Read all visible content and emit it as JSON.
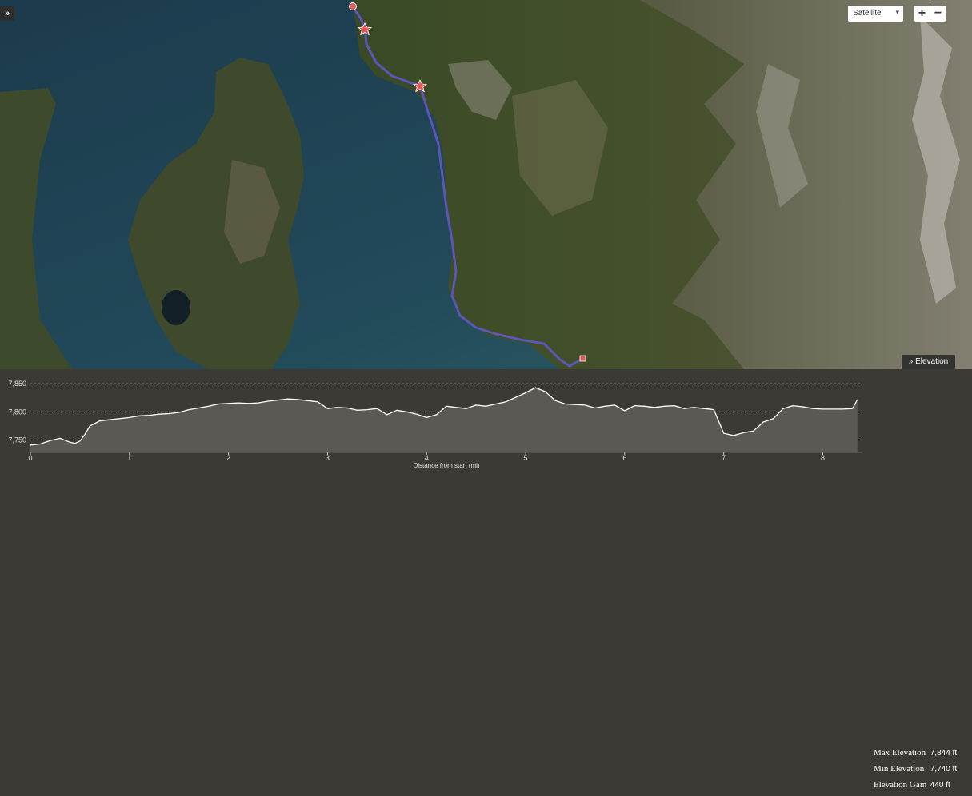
{
  "map": {
    "expand_label": "»",
    "layer_select": {
      "value": "Satellite"
    },
    "zoom_in_label": "+",
    "zoom_out_label": "−",
    "elevation_toggle_label": "Elevation",
    "route_color": "#5b56b8",
    "marker_color": "#e05a5a"
  },
  "stats": {
    "max_label": "Max Elevation",
    "max_value": "7,844 ft",
    "min_label": "Min Elevation",
    "min_value": "7,740 ft",
    "gain_label": "Elevation Gain",
    "gain_value": "440 ft"
  },
  "chart_data": {
    "type": "area",
    "xlabel": "Distance from start (mi)",
    "ylabel": "",
    "xlim": [
      0,
      8.4
    ],
    "ylim": [
      7728,
      7856
    ],
    "xticks": [
      0,
      1,
      2,
      3,
      4,
      5,
      6,
      7,
      8
    ],
    "yticks": [
      7750,
      7800,
      7850
    ],
    "ytick_labels": [
      "7,750",
      "7,800",
      "7,850"
    ],
    "fill_color": "#5a5954",
    "line_color": "#ffffff",
    "x": [
      0,
      0.1,
      0.2,
      0.3,
      0.4,
      0.45,
      0.5,
      0.55,
      0.6,
      0.7,
      0.8,
      0.9,
      1.0,
      1.1,
      1.2,
      1.3,
      1.4,
      1.5,
      1.6,
      1.7,
      1.8,
      1.9,
      2.0,
      2.1,
      2.2,
      2.3,
      2.4,
      2.5,
      2.6,
      2.7,
      2.8,
      2.9,
      3.0,
      3.1,
      3.2,
      3.3,
      3.4,
      3.5,
      3.6,
      3.7,
      3.8,
      3.9,
      4.0,
      4.1,
      4.2,
      4.3,
      4.4,
      4.5,
      4.6,
      4.7,
      4.8,
      4.9,
      5.0,
      5.1,
      5.2,
      5.3,
      5.4,
      5.5,
      5.6,
      5.7,
      5.8,
      5.9,
      6.0,
      6.1,
      6.2,
      6.3,
      6.4,
      6.5,
      6.6,
      6.7,
      6.8,
      6.9,
      7.0,
      7.1,
      7.2,
      7.3,
      7.4,
      7.5,
      7.6,
      7.7,
      7.8,
      7.9,
      8.0,
      8.1,
      8.2,
      8.3,
      8.35
    ],
    "y": [
      7741,
      7743,
      7749,
      7753,
      7746,
      7744,
      7748,
      7760,
      7775,
      7784,
      7786,
      7788,
      7790,
      7793,
      7794,
      7796,
      7797,
      7799,
      7804,
      7807,
      7810,
      7814,
      7815,
      7816,
      7815,
      7816,
      7819,
      7821,
      7823,
      7822,
      7820,
      7818,
      7806,
      7808,
      7807,
      7803,
      7804,
      7806,
      7795,
      7803,
      7800,
      7796,
      7790,
      7795,
      7810,
      7808,
      7806,
      7812,
      7810,
      7814,
      7818,
      7826,
      7834,
      7843,
      7836,
      7820,
      7814,
      7813,
      7812,
      7807,
      7810,
      7812,
      7802,
      7811,
      7810,
      7808,
      7810,
      7811,
      7806,
      7808,
      7806,
      7804,
      7762,
      7758,
      7763,
      7766,
      7782,
      7788,
      7806,
      7811,
      7809,
      7806,
      7805,
      7805,
      7805,
      7806,
      7822
    ]
  }
}
